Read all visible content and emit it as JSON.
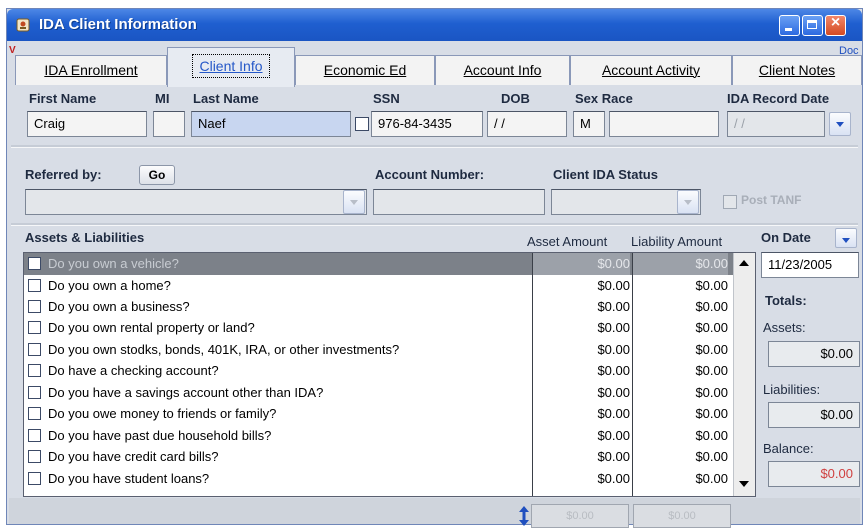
{
  "window": {
    "title": "IDA Client Information"
  },
  "corner_marks": {
    "left": "V",
    "right": "Doc"
  },
  "tabs": [
    {
      "label": "IDA Enrollment"
    },
    {
      "label": "Client Info"
    },
    {
      "label": "Economic Ed"
    },
    {
      "label": "Account Info"
    },
    {
      "label": "Account Activity"
    },
    {
      "label": "Client Notes"
    }
  ],
  "client": {
    "first_name_label": "First Name",
    "mi_label": "MI",
    "last_name_label": "Last Name",
    "ssn_label": "SSN",
    "dob_label": "DOB",
    "sex_race_label": "Sex Race",
    "record_date_label": "IDA Record Date",
    "first_name": "Craig",
    "mi": "",
    "last_name": "Naef",
    "ssn": "976-84-3435",
    "dob": " / /",
    "sex": "M",
    "race": "",
    "record_date": " / /"
  },
  "referral": {
    "referred_by_label": "Referred by:",
    "go_label": "Go",
    "account_number_label": "Account Number:",
    "status_label": "Client IDA Status",
    "post_tanf_label": "Post TANF"
  },
  "assets": {
    "section_label": "Assets & Liabilities",
    "asset_col": "Asset Amount",
    "liability_col": "Liability Amount",
    "rows": [
      {
        "q": "Do you own a vehicle?",
        "a": "$0.00",
        "l": "$0.00"
      },
      {
        "q": "Do you own a home?",
        "a": "$0.00",
        "l": "$0.00"
      },
      {
        "q": "Do you own a business?",
        "a": "$0.00",
        "l": "$0.00"
      },
      {
        "q": "Do you own rental property or land?",
        "a": "$0.00",
        "l": "$0.00"
      },
      {
        "q": "Do you own stodks, bonds, 401K, IRA, or other investments?",
        "a": "$0.00",
        "l": "$0.00"
      },
      {
        "q": "Do have a checking account?",
        "a": "$0.00",
        "l": "$0.00"
      },
      {
        "q": "Do you have a savings account other than IDA?",
        "a": "$0.00",
        "l": "$0.00"
      },
      {
        "q": "Do you owe money to friends or family?",
        "a": "$0.00",
        "l": "$0.00"
      },
      {
        "q": "Do you have past due household bills?",
        "a": "$0.00",
        "l": "$0.00"
      },
      {
        "q": "Do you have credit card bills?",
        "a": "$0.00",
        "l": "$0.00"
      },
      {
        "q": "Do you have student loans?",
        "a": "$0.00",
        "l": "$0.00"
      }
    ],
    "asset_total": "$0.00",
    "liability_total": "$0.00"
  },
  "side": {
    "on_date_label": "On Date",
    "on_date": "11/23/2005",
    "totals_label": "Totals:",
    "assets_label": "Assets:",
    "assets_value": "$0.00",
    "liabilities_label": "Liabilities:",
    "liabilities_value": "$0.00",
    "balance_label": "Balance:",
    "balance_value": "$0.00"
  },
  "colors": {
    "titlebar": "#1f5fd0",
    "balance": "#d04040",
    "active_tab_text": "#2558c8"
  },
  "icons": [
    "app-icon",
    "minimize-icon",
    "maximize-icon",
    "close-icon",
    "dropdown-arrow-icon",
    "scroll-up-icon",
    "scroll-down-icon",
    "resize-icon"
  ]
}
